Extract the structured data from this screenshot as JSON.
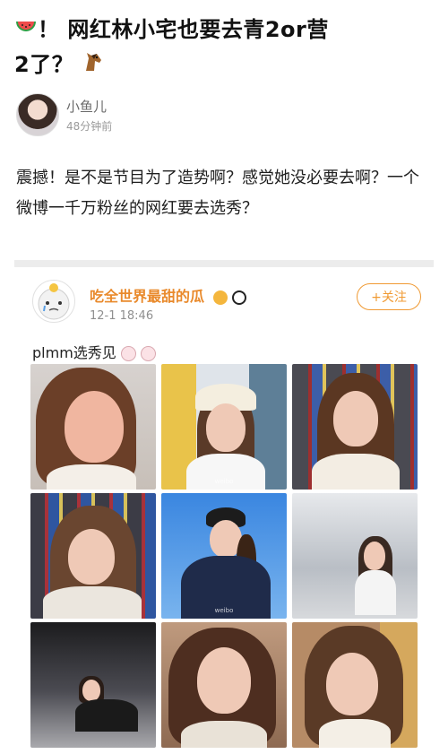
{
  "post": {
    "title_line1": "！ 网红林小宅也要去青2or营",
    "title_line2": "2了？",
    "author": "小鱼儿",
    "time": "48分钟前",
    "body": "震撼！是不是节目为了造势啊？感觉她没必要去啊？一个微博一千万粉丝的网红要去选秀？"
  },
  "repost": {
    "author": "吃全世界最甜的瓜",
    "time": "12-1 18:46",
    "follow_label": "+关注",
    "text": "plmm选秀见",
    "images": [
      {
        "name": "photo-1"
      },
      {
        "name": "photo-2"
      },
      {
        "name": "photo-3"
      },
      {
        "name": "photo-4"
      },
      {
        "name": "photo-5"
      },
      {
        "name": "photo-6"
      },
      {
        "name": "photo-7"
      },
      {
        "name": "photo-8"
      },
      {
        "name": "photo-9"
      }
    ]
  },
  "colors": {
    "accent": "#f09a33",
    "author_orange": "#e98a2c"
  },
  "icons": [
    "watermelon-icon",
    "horse-icon",
    "bunny-icon",
    "panda-icon",
    "smile-icon"
  ]
}
